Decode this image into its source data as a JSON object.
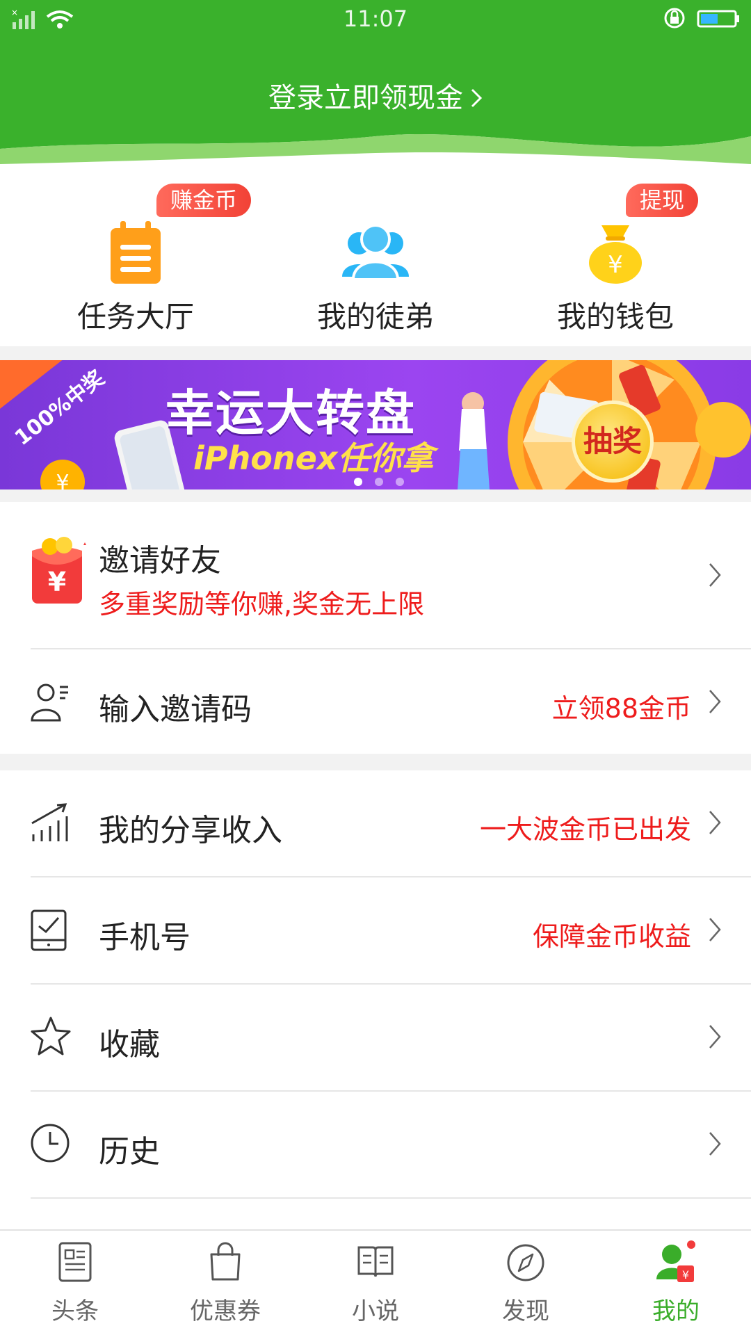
{
  "status_bar": {
    "time": "11:07"
  },
  "header": {
    "login_text": "登录立即领现金"
  },
  "shortcuts": [
    {
      "label": "任务大厅",
      "badge": "赚金币",
      "icon": "clipboard-icon"
    },
    {
      "label": "我的徒弟",
      "badge": "",
      "icon": "people-icon"
    },
    {
      "label": "我的钱包",
      "badge": "提现",
      "icon": "money-bag-icon"
    }
  ],
  "banner": {
    "ribbon": "100%中奖",
    "title": "幸运大转盘",
    "subtitle": "iPhonex任你拿",
    "button": "抽奖",
    "active_dot": 0
  },
  "invite": {
    "title": "邀请好友",
    "subtitle": "多重奖励等你赚,奖金无上限"
  },
  "menu": [
    {
      "title": "输入邀请码",
      "hint": "立领88金币",
      "icon": "user-list-icon"
    },
    {
      "title": "我的分享收入",
      "hint": "一大波金币已出发",
      "icon": "growth-chart-icon"
    },
    {
      "title": "手机号",
      "hint": "保障金币收益",
      "icon": "phone-check-icon"
    },
    {
      "title": "收藏",
      "hint": "",
      "icon": "star-icon"
    },
    {
      "title": "历史",
      "hint": "",
      "icon": "clock-icon"
    }
  ],
  "tabs": [
    {
      "label": "头条",
      "icon": "news-icon"
    },
    {
      "label": "优惠券",
      "icon": "shopping-bag-icon"
    },
    {
      "label": "小说",
      "icon": "book-icon"
    },
    {
      "label": "发现",
      "icon": "compass-icon"
    },
    {
      "label": "我的",
      "icon": "profile-icon",
      "active": true
    }
  ],
  "colors": {
    "brand_green": "#3aad2a",
    "accent_red": "#ee1c1c"
  }
}
